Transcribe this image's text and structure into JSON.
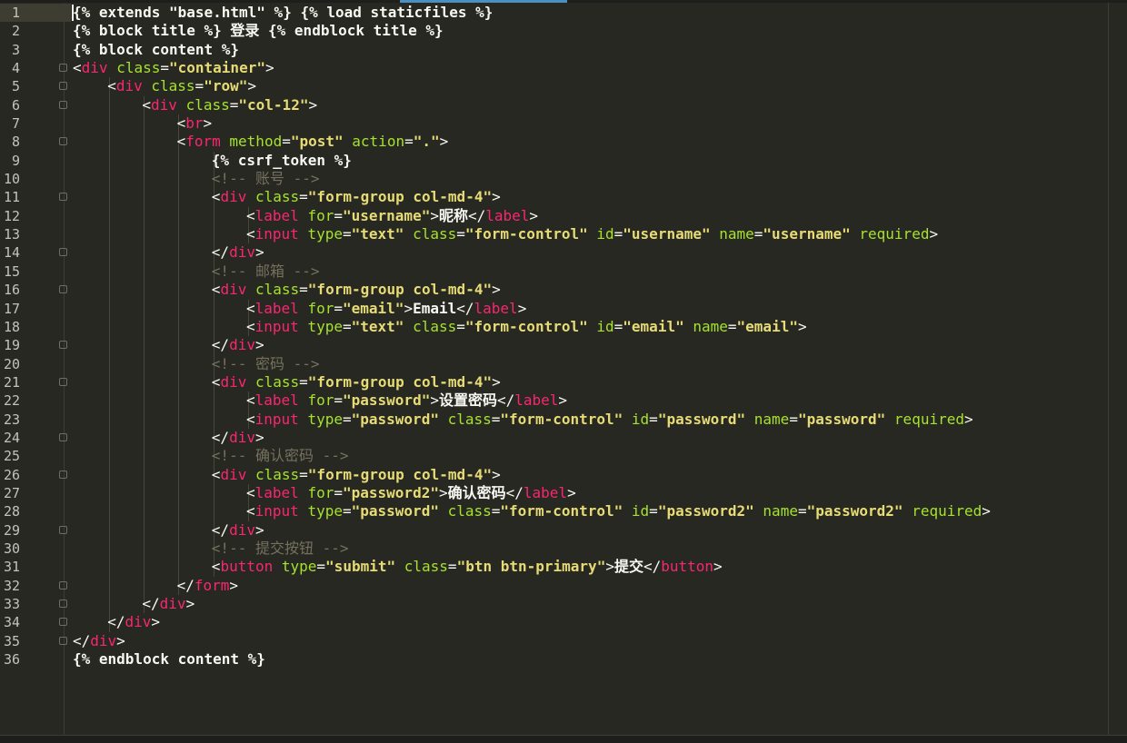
{
  "editor": {
    "theme_colors": {
      "background": "#272822",
      "tag": "#f92672",
      "attribute": "#a6e22e",
      "string": "#e6db74",
      "comment": "#75715e",
      "text": "#f8f8f2"
    },
    "lines": [
      {
        "n": "1",
        "indent": 0,
        "fold": false,
        "tokens": [
          [
            "tpl",
            "{% extends \"base.html\" %} {% load staticfiles %}"
          ]
        ]
      },
      {
        "n": "2",
        "indent": 0,
        "fold": false,
        "tokens": [
          [
            "tpl",
            "{% block title %} 登录 {% endblock title %}"
          ]
        ]
      },
      {
        "n": "3",
        "indent": 0,
        "fold": false,
        "tokens": [
          [
            "tpl",
            "{% block content %}"
          ]
        ]
      },
      {
        "n": "4",
        "indent": 0,
        "fold": true,
        "tokens": [
          [
            "punct",
            "<"
          ],
          [
            "tag",
            "div"
          ],
          [
            "punct",
            " "
          ],
          [
            "attr",
            "class"
          ],
          [
            "punct",
            "="
          ],
          [
            "str",
            "\"container\""
          ],
          [
            "punct",
            ">"
          ]
        ]
      },
      {
        "n": "5",
        "indent": 1,
        "fold": true,
        "tokens": [
          [
            "punct",
            "<"
          ],
          [
            "tag",
            "div"
          ],
          [
            "punct",
            " "
          ],
          [
            "attr",
            "class"
          ],
          [
            "punct",
            "="
          ],
          [
            "str",
            "\"row\""
          ],
          [
            "punct",
            ">"
          ]
        ]
      },
      {
        "n": "6",
        "indent": 2,
        "fold": true,
        "tokens": [
          [
            "punct",
            "<"
          ],
          [
            "tag",
            "div"
          ],
          [
            "punct",
            " "
          ],
          [
            "attr",
            "class"
          ],
          [
            "punct",
            "="
          ],
          [
            "str",
            "\"col-12\""
          ],
          [
            "punct",
            ">"
          ]
        ]
      },
      {
        "n": "7",
        "indent": 3,
        "fold": false,
        "tokens": [
          [
            "punct",
            "<"
          ],
          [
            "tag",
            "br"
          ],
          [
            "punct",
            ">"
          ]
        ]
      },
      {
        "n": "8",
        "indent": 3,
        "fold": true,
        "tokens": [
          [
            "punct",
            "<"
          ],
          [
            "tag",
            "form"
          ],
          [
            "punct",
            " "
          ],
          [
            "attr",
            "method"
          ],
          [
            "punct",
            "="
          ],
          [
            "str",
            "\"post\""
          ],
          [
            "punct",
            " "
          ],
          [
            "attr",
            "action"
          ],
          [
            "punct",
            "="
          ],
          [
            "str",
            "\".\""
          ],
          [
            "punct",
            ">"
          ]
        ]
      },
      {
        "n": "9",
        "indent": 4,
        "fold": false,
        "tokens": [
          [
            "tpl",
            "{% csrf_token %}"
          ]
        ]
      },
      {
        "n": "10",
        "indent": 4,
        "fold": false,
        "tokens": [
          [
            "cmt",
            "<!-- 账号 -->"
          ]
        ]
      },
      {
        "n": "11",
        "indent": 4,
        "fold": true,
        "tokens": [
          [
            "punct",
            "<"
          ],
          [
            "tag",
            "div"
          ],
          [
            "punct",
            " "
          ],
          [
            "attr",
            "class"
          ],
          [
            "punct",
            "="
          ],
          [
            "str",
            "\"form-group col-md-4\""
          ],
          [
            "punct",
            ">"
          ]
        ]
      },
      {
        "n": "12",
        "indent": 5,
        "fold": false,
        "tokens": [
          [
            "punct",
            "<"
          ],
          [
            "tag",
            "label"
          ],
          [
            "punct",
            " "
          ],
          [
            "attr",
            "for"
          ],
          [
            "punct",
            "="
          ],
          [
            "str",
            "\"username\""
          ],
          [
            "punct",
            ">"
          ],
          [
            "txt",
            "昵称"
          ],
          [
            "punct",
            "</"
          ],
          [
            "tag",
            "label"
          ],
          [
            "punct",
            ">"
          ]
        ]
      },
      {
        "n": "13",
        "indent": 5,
        "fold": false,
        "tokens": [
          [
            "punct",
            "<"
          ],
          [
            "tag",
            "input"
          ],
          [
            "punct",
            " "
          ],
          [
            "attr",
            "type"
          ],
          [
            "punct",
            "="
          ],
          [
            "str",
            "\"text\""
          ],
          [
            "punct",
            " "
          ],
          [
            "attr",
            "class"
          ],
          [
            "punct",
            "="
          ],
          [
            "str",
            "\"form-control\""
          ],
          [
            "punct",
            " "
          ],
          [
            "attr",
            "id"
          ],
          [
            "punct",
            "="
          ],
          [
            "str",
            "\"username\""
          ],
          [
            "punct",
            " "
          ],
          [
            "attr",
            "name"
          ],
          [
            "punct",
            "="
          ],
          [
            "str",
            "\"username\""
          ],
          [
            "punct",
            " "
          ],
          [
            "attr",
            "required"
          ],
          [
            "punct",
            ">"
          ]
        ]
      },
      {
        "n": "14",
        "indent": 4,
        "fold": true,
        "tokens": [
          [
            "punct",
            "</"
          ],
          [
            "tag",
            "div"
          ],
          [
            "punct",
            ">"
          ]
        ]
      },
      {
        "n": "15",
        "indent": 4,
        "fold": false,
        "tokens": [
          [
            "cmt",
            "<!-- 邮箱 -->"
          ]
        ]
      },
      {
        "n": "16",
        "indent": 4,
        "fold": true,
        "tokens": [
          [
            "punct",
            "<"
          ],
          [
            "tag",
            "div"
          ],
          [
            "punct",
            " "
          ],
          [
            "attr",
            "class"
          ],
          [
            "punct",
            "="
          ],
          [
            "str",
            "\"form-group col-md-4\""
          ],
          [
            "punct",
            ">"
          ]
        ]
      },
      {
        "n": "17",
        "indent": 5,
        "fold": false,
        "tokens": [
          [
            "punct",
            "<"
          ],
          [
            "tag",
            "label"
          ],
          [
            "punct",
            " "
          ],
          [
            "attr",
            "for"
          ],
          [
            "punct",
            "="
          ],
          [
            "str",
            "\"email\""
          ],
          [
            "punct",
            ">"
          ],
          [
            "txt",
            "Email"
          ],
          [
            "punct",
            "</"
          ],
          [
            "tag",
            "label"
          ],
          [
            "punct",
            ">"
          ]
        ]
      },
      {
        "n": "18",
        "indent": 5,
        "fold": false,
        "tokens": [
          [
            "punct",
            "<"
          ],
          [
            "tag",
            "input"
          ],
          [
            "punct",
            " "
          ],
          [
            "attr",
            "type"
          ],
          [
            "punct",
            "="
          ],
          [
            "str",
            "\"text\""
          ],
          [
            "punct",
            " "
          ],
          [
            "attr",
            "class"
          ],
          [
            "punct",
            "="
          ],
          [
            "str",
            "\"form-control\""
          ],
          [
            "punct",
            " "
          ],
          [
            "attr",
            "id"
          ],
          [
            "punct",
            "="
          ],
          [
            "str",
            "\"email\""
          ],
          [
            "punct",
            " "
          ],
          [
            "attr",
            "name"
          ],
          [
            "punct",
            "="
          ],
          [
            "str",
            "\"email\""
          ],
          [
            "punct",
            ">"
          ]
        ]
      },
      {
        "n": "19",
        "indent": 4,
        "fold": true,
        "tokens": [
          [
            "punct",
            "</"
          ],
          [
            "tag",
            "div"
          ],
          [
            "punct",
            ">"
          ]
        ]
      },
      {
        "n": "20",
        "indent": 4,
        "fold": false,
        "tokens": [
          [
            "cmt",
            "<!-- 密码 -->"
          ]
        ]
      },
      {
        "n": "21",
        "indent": 4,
        "fold": true,
        "tokens": [
          [
            "punct",
            "<"
          ],
          [
            "tag",
            "div"
          ],
          [
            "punct",
            " "
          ],
          [
            "attr",
            "class"
          ],
          [
            "punct",
            "="
          ],
          [
            "str",
            "\"form-group col-md-4\""
          ],
          [
            "punct",
            ">"
          ]
        ]
      },
      {
        "n": "22",
        "indent": 5,
        "fold": false,
        "tokens": [
          [
            "punct",
            "<"
          ],
          [
            "tag",
            "label"
          ],
          [
            "punct",
            " "
          ],
          [
            "attr",
            "for"
          ],
          [
            "punct",
            "="
          ],
          [
            "str",
            "\"password\""
          ],
          [
            "punct",
            ">"
          ],
          [
            "txt",
            "设置密码"
          ],
          [
            "punct",
            "</"
          ],
          [
            "tag",
            "label"
          ],
          [
            "punct",
            ">"
          ]
        ]
      },
      {
        "n": "23",
        "indent": 5,
        "fold": false,
        "tokens": [
          [
            "punct",
            "<"
          ],
          [
            "tag",
            "input"
          ],
          [
            "punct",
            " "
          ],
          [
            "attr",
            "type"
          ],
          [
            "punct",
            "="
          ],
          [
            "str",
            "\"password\""
          ],
          [
            "punct",
            " "
          ],
          [
            "attr",
            "class"
          ],
          [
            "punct",
            "="
          ],
          [
            "str",
            "\"form-control\""
          ],
          [
            "punct",
            " "
          ],
          [
            "attr",
            "id"
          ],
          [
            "punct",
            "="
          ],
          [
            "str",
            "\"password\""
          ],
          [
            "punct",
            " "
          ],
          [
            "attr",
            "name"
          ],
          [
            "punct",
            "="
          ],
          [
            "str",
            "\"password\""
          ],
          [
            "punct",
            " "
          ],
          [
            "attr",
            "required"
          ],
          [
            "punct",
            ">"
          ]
        ]
      },
      {
        "n": "24",
        "indent": 4,
        "fold": true,
        "tokens": [
          [
            "punct",
            "</"
          ],
          [
            "tag",
            "div"
          ],
          [
            "punct",
            ">"
          ]
        ]
      },
      {
        "n": "25",
        "indent": 4,
        "fold": false,
        "tokens": [
          [
            "cmt",
            "<!-- 确认密码 -->"
          ]
        ]
      },
      {
        "n": "26",
        "indent": 4,
        "fold": true,
        "tokens": [
          [
            "punct",
            "<"
          ],
          [
            "tag",
            "div"
          ],
          [
            "punct",
            " "
          ],
          [
            "attr",
            "class"
          ],
          [
            "punct",
            "="
          ],
          [
            "str",
            "\"form-group col-md-4\""
          ],
          [
            "punct",
            ">"
          ]
        ]
      },
      {
        "n": "27",
        "indent": 5,
        "fold": false,
        "tokens": [
          [
            "punct",
            "<"
          ],
          [
            "tag",
            "label"
          ],
          [
            "punct",
            " "
          ],
          [
            "attr",
            "for"
          ],
          [
            "punct",
            "="
          ],
          [
            "str",
            "\"password2\""
          ],
          [
            "punct",
            ">"
          ],
          [
            "txt",
            "确认密码"
          ],
          [
            "punct",
            "</"
          ],
          [
            "tag",
            "label"
          ],
          [
            "punct",
            ">"
          ]
        ]
      },
      {
        "n": "28",
        "indent": 5,
        "fold": false,
        "tokens": [
          [
            "punct",
            "<"
          ],
          [
            "tag",
            "input"
          ],
          [
            "punct",
            " "
          ],
          [
            "attr",
            "type"
          ],
          [
            "punct",
            "="
          ],
          [
            "str",
            "\"password\""
          ],
          [
            "punct",
            " "
          ],
          [
            "attr",
            "class"
          ],
          [
            "punct",
            "="
          ],
          [
            "str",
            "\"form-control\""
          ],
          [
            "punct",
            " "
          ],
          [
            "attr",
            "id"
          ],
          [
            "punct",
            "="
          ],
          [
            "str",
            "\"password2\""
          ],
          [
            "punct",
            " "
          ],
          [
            "attr",
            "name"
          ],
          [
            "punct",
            "="
          ],
          [
            "str",
            "\"password2\""
          ],
          [
            "punct",
            " "
          ],
          [
            "attr",
            "required"
          ],
          [
            "punct",
            ">"
          ]
        ]
      },
      {
        "n": "29",
        "indent": 4,
        "fold": true,
        "tokens": [
          [
            "punct",
            "</"
          ],
          [
            "tag",
            "div"
          ],
          [
            "punct",
            ">"
          ]
        ]
      },
      {
        "n": "30",
        "indent": 4,
        "fold": false,
        "tokens": [
          [
            "cmt",
            "<!-- 提交按钮 -->"
          ]
        ]
      },
      {
        "n": "31",
        "indent": 4,
        "fold": false,
        "tokens": [
          [
            "punct",
            "<"
          ],
          [
            "tag",
            "button"
          ],
          [
            "punct",
            " "
          ],
          [
            "attr",
            "type"
          ],
          [
            "punct",
            "="
          ],
          [
            "str",
            "\"submit\""
          ],
          [
            "punct",
            " "
          ],
          [
            "attr",
            "class"
          ],
          [
            "punct",
            "="
          ],
          [
            "str",
            "\"btn btn-primary\""
          ],
          [
            "punct",
            ">"
          ],
          [
            "txt",
            "提交"
          ],
          [
            "punct",
            "</"
          ],
          [
            "tag",
            "button"
          ],
          [
            "punct",
            ">"
          ]
        ]
      },
      {
        "n": "32",
        "indent": 3,
        "fold": true,
        "tokens": [
          [
            "punct",
            "</"
          ],
          [
            "tag",
            "form"
          ],
          [
            "punct",
            ">"
          ]
        ]
      },
      {
        "n": "33",
        "indent": 2,
        "fold": true,
        "tokens": [
          [
            "punct",
            "</"
          ],
          [
            "tag",
            "div"
          ],
          [
            "punct",
            ">"
          ]
        ]
      },
      {
        "n": "34",
        "indent": 1,
        "fold": true,
        "tokens": [
          [
            "punct",
            "</"
          ],
          [
            "tag",
            "div"
          ],
          [
            "punct",
            ">"
          ]
        ]
      },
      {
        "n": "35",
        "indent": 0,
        "fold": true,
        "tokens": [
          [
            "punct",
            "</"
          ],
          [
            "tag",
            "div"
          ],
          [
            "punct",
            ">"
          ]
        ]
      },
      {
        "n": "36",
        "indent": 0,
        "fold": false,
        "tokens": [
          [
            "tpl",
            "{% endblock content %}"
          ]
        ]
      }
    ]
  }
}
